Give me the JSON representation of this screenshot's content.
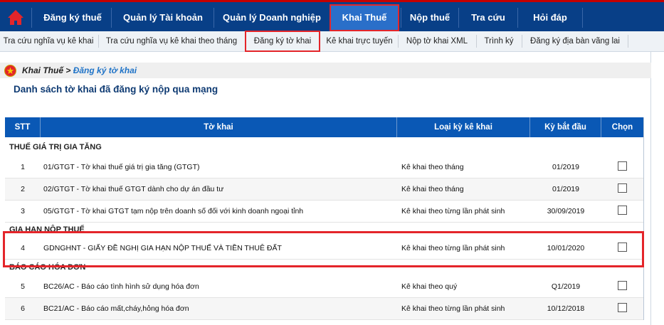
{
  "nav": {
    "items": [
      "Đăng ký thuế",
      "Quản lý Tài khoản",
      "Quản lý Doanh nghiệp",
      "Khai Thuế",
      "Nộp thuế",
      "Tra cứu",
      "Hỏi đáp"
    ],
    "active": "Khai Thuế",
    "colors": {
      "bar": "#083f87",
      "active": "#2a6fc9",
      "highlight": "#e4252a"
    }
  },
  "subnav": {
    "items": [
      "Tra cứu nghĩa vụ kê khai",
      "Tra cứu nghĩa vụ kê khai theo tháng",
      "Đăng ký tờ khai",
      "Kê khai trực tuyến",
      "Nộp tờ khai XML",
      "Trình ký",
      "Đăng ký địa bàn vãng lai"
    ],
    "active": "Đăng ký tờ khai"
  },
  "breadcrumb": {
    "root": "Khai Thuế >",
    "current": "Đăng ký tờ khai"
  },
  "page_title": "Danh sách tờ khai đã đăng ký nộp qua mạng",
  "table": {
    "headers": [
      "STT",
      "Tờ khai",
      "Loại kỳ kê khai",
      "Kỳ bắt đầu",
      "Chọn"
    ],
    "groups": [
      {
        "title": "THUẾ GIÁ TRỊ GIA TĂNG",
        "rows": [
          {
            "stt": "1",
            "name": "01/GTGT - Tờ khai thuế giá trị gia tăng (GTGT)",
            "type": "Kê khai theo tháng",
            "start": "01/2019",
            "checked": false
          },
          {
            "stt": "2",
            "name": "02/GTGT - Tờ khai thuế GTGT dành cho dự án đầu tư",
            "type": "Kê khai theo tháng",
            "start": "01/2019",
            "checked": false
          },
          {
            "stt": "3",
            "name": "05/GTGT - Tờ khai GTGT tạm nộp trên doanh số đối với kinh doanh ngoại tỉnh",
            "type": "Kê khai theo từng lần phát sinh",
            "start": "30/09/2019",
            "checked": false
          }
        ]
      },
      {
        "title": "GIA HẠN NỘP THUẾ",
        "rows": [
          {
            "stt": "4",
            "name": "GDNGHNT - GIẤY ĐỀ NGHỊ GIA HẠN NỘP THUẾ VÀ TIỀN THUÊ ĐẤT",
            "type": "Kê khai theo từng lần phát sinh",
            "start": "10/01/2020",
            "checked": false
          }
        ]
      },
      {
        "title": "BÁO CÁO HÓA ĐƠN",
        "rows": [
          {
            "stt": "5",
            "name": "BC26/AC - Báo cáo tình hình sử dụng hóa đơn",
            "type": "Kê khai theo quý",
            "start": "Q1/2019",
            "checked": false
          },
          {
            "stt": "6",
            "name": "BC21/AC - Báo cáo mất,cháy,hỏng hóa đơn",
            "type": "Kê khai theo từng lần phát sinh",
            "start": "10/12/2018",
            "checked": false
          }
        ]
      }
    ]
  }
}
